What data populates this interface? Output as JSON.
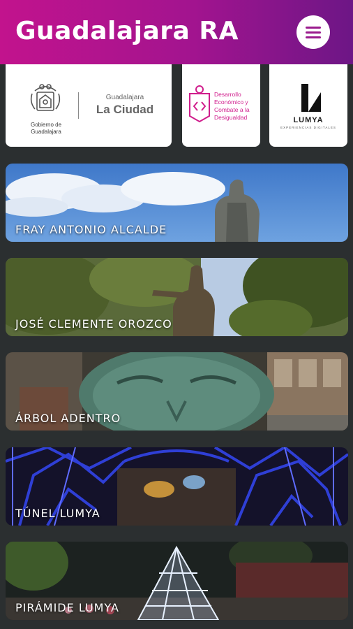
{
  "header": {
    "title": "Guadalajara  RA",
    "menu_icon": "hamburger-menu-icon"
  },
  "logos": {
    "gobierno": {
      "small_text": "Gobierno de Guadalajara",
      "city_top": "Guadalajara",
      "city_name": "La Ciudad"
    },
    "desarrollo": {
      "lines": [
        "Desarrollo",
        "Económico y",
        "Combate a la",
        "Desigualdad"
      ]
    },
    "lumya": {
      "name": "LUMYA",
      "tagline": "EXPERIENCIAS DIGITALES"
    }
  },
  "places": [
    {
      "label": "FRAY ANTONIO ALCALDE"
    },
    {
      "label": "JOSÉ CLEMENTE OROZCO"
    },
    {
      "label": "ÁRBOL ADENTRO"
    },
    {
      "label": "TÚNEL LUMYA"
    },
    {
      "label": "PIRÁMIDE LUMYA"
    }
  ],
  "colors": {
    "header_start": "#c2138d",
    "header_end": "#6d1686",
    "background": "#2b2f30",
    "desarrollo_pink": "#d01d8c"
  }
}
